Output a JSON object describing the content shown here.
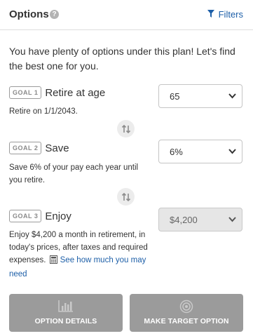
{
  "header": {
    "title": "Options",
    "help_glyph": "?",
    "filters_label": "Filters"
  },
  "intro": "You have plenty of options under this plan! Let's find the best one for you.",
  "goals": [
    {
      "badge": "GOAL 1",
      "name": "Retire at age",
      "description": "Retire on 1/1/2043.",
      "selected": "65",
      "disabled": false
    },
    {
      "badge": "GOAL 2",
      "name": "Save",
      "description": "Save 6% of your pay each year until you retire.",
      "selected": "6%",
      "disabled": false
    },
    {
      "badge": "GOAL 3",
      "name": "Enjoy",
      "description": "Enjoy $4,200 a month in retirement, in today's prices, after taxes and required expenses.",
      "link_text": "See how much you may need",
      "selected": "$4,200",
      "disabled": true
    }
  ],
  "buttons": {
    "option_details": "OPTION DETAILS",
    "make_target": "MAKE TARGET OPTION"
  },
  "colors": {
    "link": "#1d5fa8",
    "button_disabled": "#9b9b9b",
    "select_disabled": "#e6e6e6"
  },
  "icons": [
    "help-icon",
    "filter-icon",
    "swap-icon",
    "calculator-icon",
    "bar-chart-icon",
    "target-icon",
    "chevron-down-icon"
  ]
}
